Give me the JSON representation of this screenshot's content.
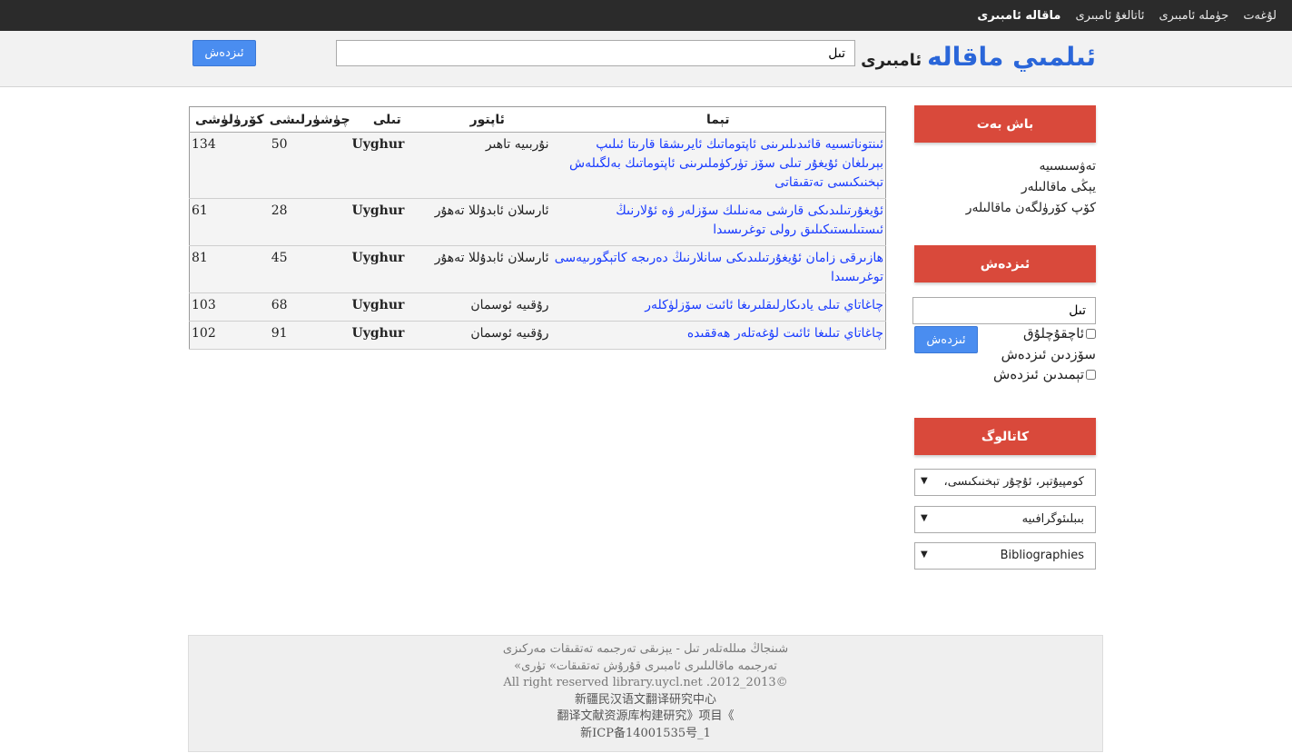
{
  "nav": [
    "لۇغەت",
    "جۈملە ئامبىرى",
    "ئاتالغۇ ئامبىرى",
    "ماقالە ئامبىرى"
  ],
  "header": {
    "logo_main": "ئىلمىي ماقالە",
    "logo_sub": "ئامبىرى",
    "search_value": "تىل",
    "search_button": "ئىزدەش"
  },
  "table": {
    "headers": {
      "title": "تېما",
      "author": "ئاپتور",
      "lang": "تىلى",
      "downloads": "چۈشۈرلىشى",
      "views": "كۆرۈلۈشى"
    },
    "rows": [
      {
        "title": "ئىنتوناتسىيە قائىدىلىرىنى ئاپتوماتىك ئايرىشقا قارىتا ئىلىپ بېرىلغان ئۇيغۇر تىلى سۆز تۈركۈملىرىنى ئاپتوماتىك بەلگىلەش تېخنىكىسى تەتقىقاتى",
        "author": "نۇربىيە تاھىر",
        "lang": "Uyghur",
        "downloads": "50",
        "views": "134"
      },
      {
        "title": "ئۇيغۇرتىلىدىكى قارشى مەنىلىك سۆزلەر ۋە ئۇلارنىڭ ئىستىلىستىكىلىق رولى توغرىسىدا",
        "author": "ئارسلان ئابدۇللا تەھۇر",
        "lang": "Uyghur",
        "downloads": "28",
        "views": "61"
      },
      {
        "title": "ھازىرقى زامان ئۇيغۇرتىلىدىكى سانلارنىڭ دەرىجە كاتېگورىيەسى توغرىسىدا",
        "author": "ئارسلان ئابدۇللا تەھۇر",
        "lang": "Uyghur",
        "downloads": "45",
        "views": "81"
      },
      {
        "title": "چاغاتاي تىلى يادىكارلىقلىرىغا ئائىت سۆزلۈكلەر",
        "author": "رۇقىيە ئوسمان",
        "lang": "Uyghur",
        "downloads": "68",
        "views": "103"
      },
      {
        "title": "چاغاتاي تىلىغا ئائىت لۇغەتلەر ھەققىدە",
        "author": "رۇقىيە ئوسمان",
        "lang": "Uyghur",
        "downloads": "91",
        "views": "102"
      }
    ]
  },
  "sidebar": {
    "home_head": "باش بەت",
    "links": [
      "تەۋسىسىيە",
      "يېڭى ماقالىلەر",
      "كۆپ كۆرۈلگەن ماقالىلەر"
    ],
    "search_head": "ئىزدەش",
    "search_value": "تىل",
    "search_button": "ئىزدەش",
    "opt_fuzzy": "ئاچقۇچلۇق",
    "opt_word": "سۆزدىن ئىزدەش",
    "opt_topic": "تېمىدىن ئىزدەش",
    "catalog_head": "كاتالوگ",
    "selects": [
      "كومپيۇتېر، ئۇچۇر تېخنىكىسى،",
      "بىبلىئوگرافىيە",
      "Bibliographies"
    ]
  },
  "footer": {
    "line1": "شىنجاڭ مىللەتلەر تىل - يېزىقى تەرجىمە تەتقىقات مەركىزى",
    "line2": "«تەرجىمە ماقالىلىرى ئامبىرى قۇرۇش تەتقىقات» تۈرى",
    "line3": "All right reserved library.uycl.net .2012_2013©",
    "line4": "新疆民汉语文翻译研究中心",
    "line5": "翻译文献资源库构建研究》项目《",
    "line6": "新ICP备14001535号_1"
  }
}
